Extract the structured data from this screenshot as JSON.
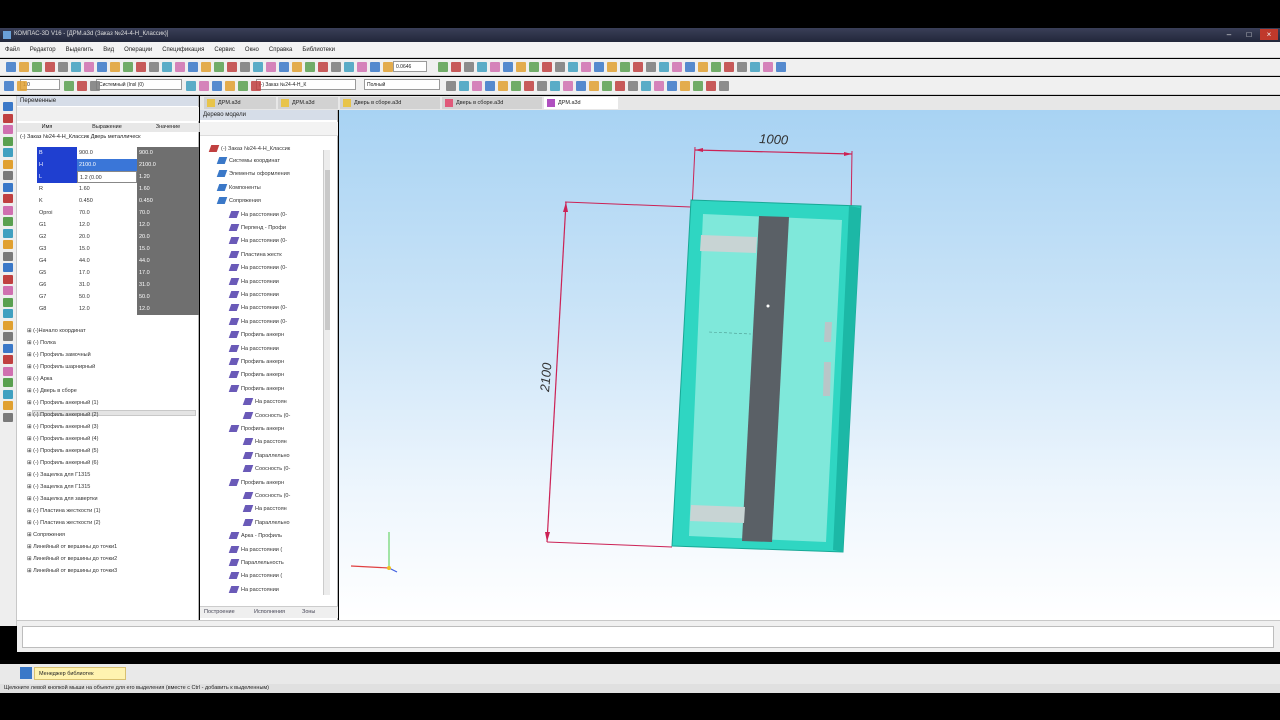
{
  "window": {
    "title": "КОМПАС-3D V16 - [ДРМ.a3d (Заказ №24-4-Н_Классик)]"
  },
  "menu": [
    "Файл",
    "Редактор",
    "Выделить",
    "Вид",
    "Операции",
    "Спецификация",
    "Сервис",
    "Окно",
    "Справка",
    "Библиотеки"
  ],
  "toolbar": {
    "zoom_value": "0.0646",
    "line_width": "1.0",
    "coord_system": "Системный (Insl (0)",
    "doc_select": "(-) Заказ №24-4-Н_К",
    "view_mode": "Полный"
  },
  "doc_tabs": [
    {
      "label": "ДРМ.a3d",
      "color": "#e8c44a"
    },
    {
      "label": "ДРМ.a3d",
      "color": "#e8c44a"
    },
    {
      "label": "Дверь в сборе.a3d",
      "color": "#e8c44a"
    },
    {
      "label": "Дверь в сборе.a3d",
      "color": "#e05a7a"
    },
    {
      "label": "ДРМ.a3d",
      "color": "#b050c0"
    }
  ],
  "variables_panel": {
    "title": "Переменные",
    "columns": [
      "Имя",
      "Выражение",
      "Значение"
    ],
    "root": "(-) Заказ №24-4-Н_Классик Дверь металлическ",
    "rows": [
      {
        "name": "B",
        "expr": "900.0",
        "value": "900.0"
      },
      {
        "name": "H",
        "expr": "2100.0",
        "value": "2100.0"
      },
      {
        "name": "L",
        "expr": "1.2 (0.00",
        "value": "1.20"
      },
      {
        "name": "R",
        "expr": "1.60",
        "value": "1.60"
      },
      {
        "name": "K",
        "expr": "0.450",
        "value": "0.450"
      },
      {
        "name": "Oproi",
        "expr": "70.0",
        "value": "70.0"
      },
      {
        "name": "G1",
        "expr": "12.0",
        "value": "12.0"
      },
      {
        "name": "G2",
        "expr": "20.0",
        "value": "20.0"
      },
      {
        "name": "G3",
        "expr": "15.0",
        "value": "15.0"
      },
      {
        "name": "G4",
        "expr": "44.0",
        "value": "44.0"
      },
      {
        "name": "G5",
        "expr": "17.0",
        "value": "17.0"
      },
      {
        "name": "G6",
        "expr": "31.0",
        "value": "31.0"
      },
      {
        "name": "G7",
        "expr": "50.0",
        "value": "50.0"
      },
      {
        "name": "G8",
        "expr": "12.0",
        "value": "12.0"
      }
    ],
    "tree": [
      "⊞ (-)Начало координат",
      "⊞ (-) Полка",
      "⊞ (-) Профиль замочный",
      "⊞ (-) Профиль шарнирный",
      "⊞ (-) Арка",
      "⊞ (-) Дверь в сборе",
      "⊞ (-) Профиль анкерный (1)",
      "⊞ (-) Профиль анкерный (2)",
      "⊞ (-) Профиль анкерный (3)",
      "⊞ (-) Профиль анкерный (4)",
      "⊞ (-) Профиль анкерный (5)",
      "⊞ (-) Профиль анкерный (6)",
      "⊞ (-) Защелка для Г1315",
      "⊞ (-) Защелка для Г1315",
      "⊞ (-) Защелка для завертки",
      "⊞ (-) Пластина жесткости (1)",
      "⊞ (-) Пластина жесткости (2)",
      "⊞ Сопряжения",
      "⊞ Линейный от вершины до точки1",
      "⊞ Линейный от вершины до точки2",
      "⊞ Линейный от вершины до точки3"
    ]
  },
  "tree_panel": {
    "title": "Дерево модели",
    "root": "(-) Заказ №24-4-Н_Классик",
    "nodes": [
      {
        "label": "Системы координат",
        "level": 1
      },
      {
        "label": "Элементы оформления",
        "level": 1
      },
      {
        "label": "Компоненты",
        "level": 1
      },
      {
        "label": "Сопряжения",
        "level": 1
      },
      {
        "label": "На расстоянии (0-",
        "level": 2
      },
      {
        "label": "Перпенд - Профи",
        "level": 2
      },
      {
        "label": "На расстоянии (0-",
        "level": 2
      },
      {
        "label": "Пластина жестк",
        "level": 2
      },
      {
        "label": "На расстоянии (0-",
        "level": 2
      },
      {
        "label": "На расстоянии",
        "level": 2
      },
      {
        "label": "На расстоянии",
        "level": 2
      },
      {
        "label": "На расстоянии (0-",
        "level": 2
      },
      {
        "label": "На расстоянии (0-",
        "level": 2
      },
      {
        "label": "Профиль анкерн",
        "level": 2
      },
      {
        "label": "На расстоянии",
        "level": 2
      },
      {
        "label": "Профиль анкерн",
        "level": 2
      },
      {
        "label": "Профиль анкерн",
        "level": 2
      },
      {
        "label": "Профиль анкерн",
        "level": 2
      },
      {
        "label": "На расстоян",
        "level": 3
      },
      {
        "label": "Соосность (0-",
        "level": 3
      },
      {
        "label": "Профиль анкерн",
        "level": 2
      },
      {
        "label": "На расстоян",
        "level": 3
      },
      {
        "label": "Параллельно",
        "level": 3
      },
      {
        "label": "Соосность (0-",
        "level": 3
      },
      {
        "label": "Профиль анкерн",
        "level": 2
      },
      {
        "label": "Соосность (0-",
        "level": 3
      },
      {
        "label": "На расстоян",
        "level": 3
      },
      {
        "label": "Параллельно",
        "level": 3
      },
      {
        "label": "Арка - Профиль",
        "level": 2
      },
      {
        "label": "На расстоянии (",
        "level": 2
      },
      {
        "label": "Параллельность",
        "level": 2
      },
      {
        "label": "На расстоянии (",
        "level": 2
      },
      {
        "label": "На расстоянии",
        "level": 2
      }
    ],
    "bottom_tabs": [
      "Построение",
      "Исполнения",
      "Зоны"
    ]
  },
  "viewport": {
    "dim_width": "1000",
    "dim_height": "2100",
    "door_color": "#3fe0cc"
  },
  "taskbar": {
    "button": "Менеджер библиотек"
  },
  "status": "Щелкните левой кнопкой мыши на объекте для его выделения (вместе с Ctrl - добавить к выделенным)"
}
